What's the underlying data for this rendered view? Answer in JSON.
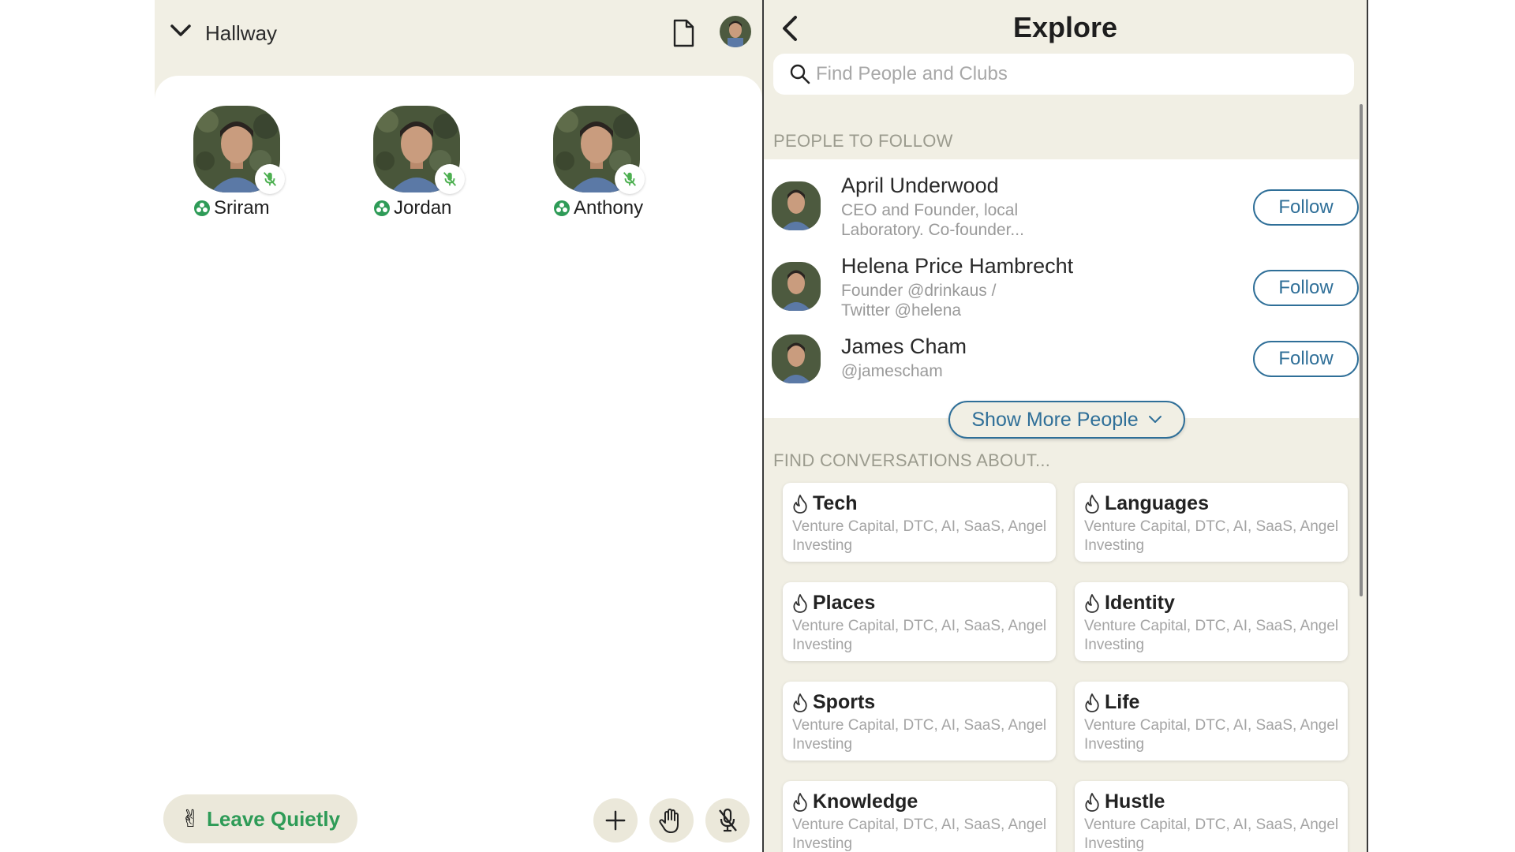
{
  "room": {
    "title": "Hallway",
    "speakers": [
      {
        "name": "Sriram"
      },
      {
        "name": "Jordan"
      },
      {
        "name": "Anthony"
      }
    ],
    "leave_label": "Leave Quietly",
    "leave_emoji": "✌"
  },
  "explore": {
    "title": "Explore",
    "search_placeholder": "Find People and Clubs",
    "people_section": "PEOPLE TO FOLLOW",
    "people": [
      {
        "name": "April Underwood",
        "bio": "CEO and Founder, local Laboratory. Co-founder...",
        "follow": "Follow"
      },
      {
        "name": "Helena Price Hambrecht",
        "bio": "Founder @drinkaus / Twitter @helena",
        "follow": "Follow"
      },
      {
        "name": "James Cham",
        "bio": "@jamescham",
        "follow": "Follow"
      }
    ],
    "show_more_label": "Show More People",
    "conversations_section": "FIND CONVERSATIONS ABOUT...",
    "topics": [
      {
        "name": "Tech",
        "desc": "Venture Capital, DTC, AI, SaaS, Angel Investing"
      },
      {
        "name": "Languages",
        "desc": "Venture Capital, DTC, AI, SaaS, Angel Investing"
      },
      {
        "name": "Places",
        "desc": "Venture Capital, DTC, AI, SaaS, Angel Investing"
      },
      {
        "name": "Identity",
        "desc": "Venture Capital, DTC, AI, SaaS, Angel Investing"
      },
      {
        "name": "Sports",
        "desc": "Venture Capital, DTC, AI, SaaS, Angel Investing"
      },
      {
        "name": "Life",
        "desc": "Venture Capital, DTC, AI, SaaS, Angel Investing"
      },
      {
        "name": "Knowledge",
        "desc": "Venture Capital, DTC, AI, SaaS, Angel Investing"
      },
      {
        "name": "Hustle",
        "desc": "Venture Capital, DTC, AI, SaaS, Angel Investing"
      }
    ]
  },
  "colors": {
    "panel_bg": "#f1efe4",
    "accent_blue": "#2f6f98",
    "accent_green": "#2e9b57",
    "muted_text": "#9a9a9a"
  },
  "icons": {
    "collapse": "chevron-down-icon",
    "document": "document-icon",
    "muted_mic": "mic-off-icon",
    "moderator_badge": "moderator-badge-icon",
    "add": "plus-icon",
    "raise_hand": "raise-hand-icon",
    "mute_self": "mic-off-icon",
    "back": "chevron-left-icon",
    "search": "search-icon",
    "topic": "flame-icon"
  }
}
